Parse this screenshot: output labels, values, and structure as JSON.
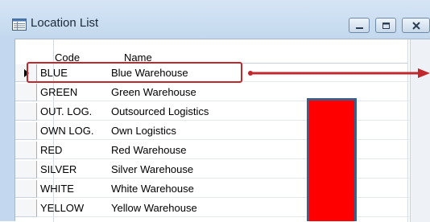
{
  "window": {
    "title": "Location List",
    "title_icon": "list-form-icon",
    "buttons": {
      "minimize_icon": "minimize-icon",
      "maximize_icon": "maximize-icon",
      "close_icon": "close-icon"
    }
  },
  "table": {
    "columns": [
      "Code",
      "Name"
    ],
    "rows": [
      {
        "code": "BLUE",
        "name": "Blue Warehouse",
        "selected": true
      },
      {
        "code": "GREEN",
        "name": "Green Warehouse"
      },
      {
        "code": "OUT. LOG.",
        "name": "Outsourced Logistics"
      },
      {
        "code": "OWN LOG.",
        "name": "Own Logistics"
      },
      {
        "code": "RED",
        "name": "Red Warehouse"
      },
      {
        "code": "SILVER",
        "name": "Silver Warehouse"
      },
      {
        "code": "WHITE",
        "name": "White Warehouse"
      },
      {
        "code": "YELLOW",
        "name": "Yellow Warehouse"
      }
    ],
    "row_selector_icon": "current-row-arrow-icon"
  },
  "annotations": {
    "highlight_color": "#c0282d",
    "arrow_icon": "right-arrow-icon",
    "red_block_color": "#ff0000"
  }
}
